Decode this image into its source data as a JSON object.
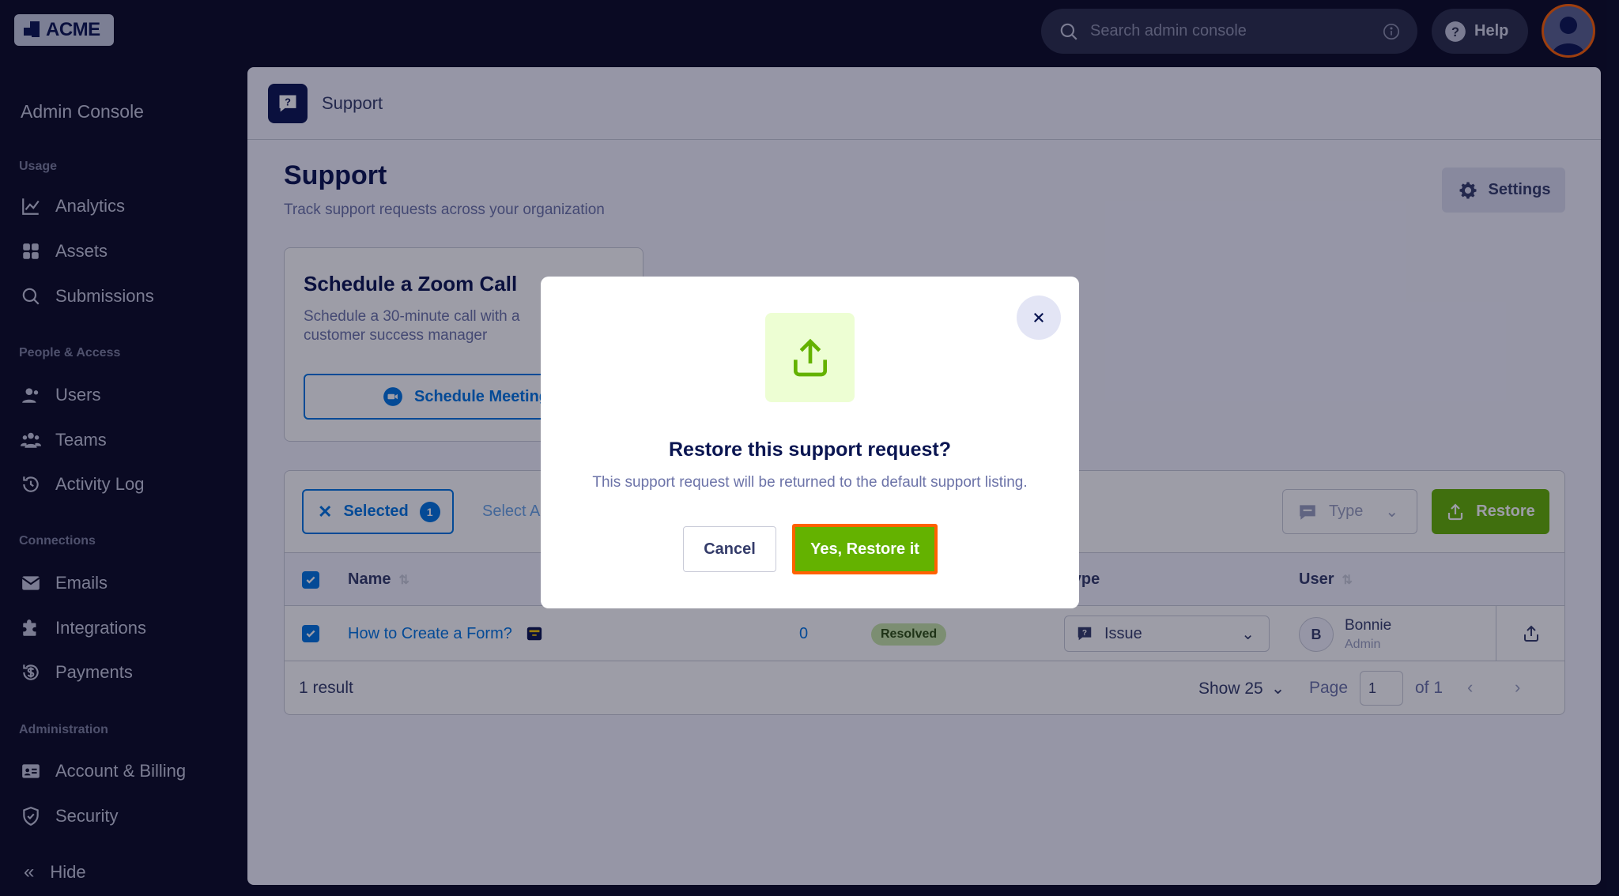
{
  "topbar": {
    "logo_text": "ACME",
    "search_placeholder": "Search admin console",
    "help_label": "Help"
  },
  "sidebar": {
    "title": "Admin Console",
    "sections": [
      {
        "label": "Usage",
        "items": [
          {
            "label": "Analytics",
            "icon": "chart-line-icon"
          },
          {
            "label": "Assets",
            "icon": "assets-grid-icon"
          },
          {
            "label": "Submissions",
            "icon": "search-icon"
          }
        ]
      },
      {
        "label": "People & Access",
        "items": [
          {
            "label": "Users",
            "icon": "user-icon"
          },
          {
            "label": "Teams",
            "icon": "team-icon"
          },
          {
            "label": "Activity Log",
            "icon": "history-icon"
          }
        ]
      },
      {
        "label": "Connections",
        "items": [
          {
            "label": "Emails",
            "icon": "envelope-icon"
          },
          {
            "label": "Integrations",
            "icon": "puzzle-icon"
          },
          {
            "label": "Payments",
            "icon": "dollar-icon"
          }
        ]
      },
      {
        "label": "Administration",
        "items": [
          {
            "label": "Account & Billing",
            "icon": "id-card-icon"
          },
          {
            "label": "Security",
            "icon": "shield-icon"
          }
        ]
      }
    ],
    "hide_label": "Hide"
  },
  "panel": {
    "header_title": "Support",
    "page_title": "Support",
    "page_subtitle": "Track support requests across your organization",
    "settings_label": "Settings"
  },
  "zoom_card": {
    "title": "Schedule a Zoom Call",
    "description": "Schedule a 30-minute call with a customer success manager",
    "button_label": "Schedule Meeting"
  },
  "table": {
    "selected_label": "Selected",
    "selected_count": "1",
    "select_all_label": "Select All",
    "type_filter_label": "Type",
    "restore_label": "Restore",
    "columns": [
      "Name",
      "Type",
      "User"
    ],
    "rows": [
      {
        "name": "How to Create a Form?",
        "count": "0",
        "status": "Resolved",
        "type": "Issue",
        "user_initial": "B",
        "user_name": "Bonnie",
        "user_role": "Admin"
      }
    ],
    "footer": {
      "result_count": "1 result",
      "show_label": "Show 25",
      "page_label": "Page",
      "page_value": "1",
      "page_of": "of 1"
    }
  },
  "modal": {
    "title": "Restore this support request?",
    "description": "This support request will be returned to the default support listing.",
    "cancel_label": "Cancel",
    "confirm_label": "Yes, Restore it",
    "icon": "upload-icon"
  },
  "colors": {
    "brand_navy": "#0a1551",
    "accent_blue": "#0075e3",
    "success_green": "#64b200",
    "highlight_orange": "#ff6100"
  }
}
